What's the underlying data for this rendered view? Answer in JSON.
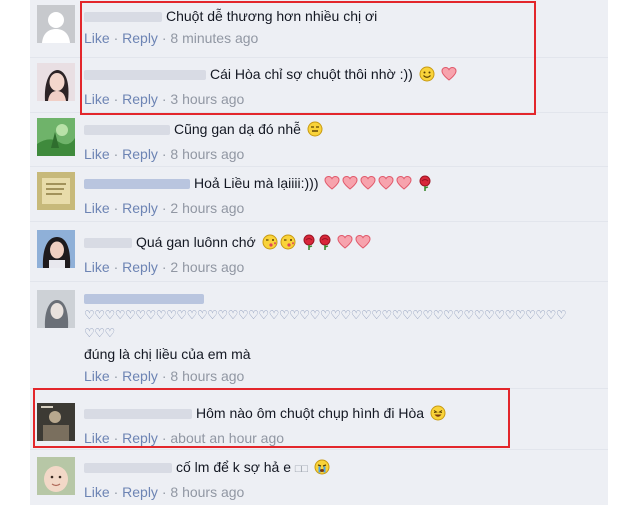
{
  "colors": {
    "link": "#6d84b4",
    "timestamp": "#9197a3",
    "text": "#141823",
    "comment_bg": "#edeff4",
    "highlight": "#e3262b",
    "heart": "#f7a3ad"
  },
  "actions": {
    "like": "Like",
    "reply": "Reply",
    "separator": "·"
  },
  "comments": [
    {
      "text": "Chuột dễ thương hơn nhiều chị ơi",
      "time": "8 minutes ago",
      "emoticons": []
    },
    {
      "text": "Cái Hòa chỉ sợ chuột thôi nhờ :))",
      "time": "3 hours ago",
      "emoticons": [
        "smile-emoji",
        "heart-emoji"
      ]
    },
    {
      "text": "Cũng gan dạ đó nhễ",
      "time": "8 hours ago",
      "emoticons": [
        "grin-emoji"
      ]
    },
    {
      "text": "Hoả Liều mà lạiiii:)))",
      "time": "2 hours ago",
      "emoticons": [
        "heart-emoji",
        "heart-emoji",
        "heart-emoji",
        "heart-emoji",
        "heart-emoji",
        "rose-emoji"
      ]
    },
    {
      "text": "Quá gan luônn chớ",
      "time": "2 hours ago",
      "emoticons": [
        "kiss-emoji",
        "kiss-emoji",
        "rose-emoji",
        "rose-emoji",
        "heart-emoji",
        "heart-emoji"
      ]
    },
    {
      "hearts_row": "♡♡♡♡♡♡♡♡♡♡♡♡♡♡♡♡♡♡♡♡♡♡♡♡♡♡♡♡♡♡♡♡♡♡♡♡♡♡♡♡♡♡♡♡♡♡♡",
      "hearts_row2": "♡♡♡",
      "text": "đúng là chị liều của em mà",
      "time": "8 hours ago",
      "emoticons": []
    },
    {
      "text": "Hôm nào ôm chuột chụp hình đi Hòa",
      "time": "about an hour ago",
      "emoticons": [
        "laugh-emoji"
      ]
    },
    {
      "text": "cố lm để k sợ hả e",
      "suffix": "□□",
      "time": "8 hours ago",
      "emoticons": [
        "cry-emoji"
      ]
    }
  ]
}
